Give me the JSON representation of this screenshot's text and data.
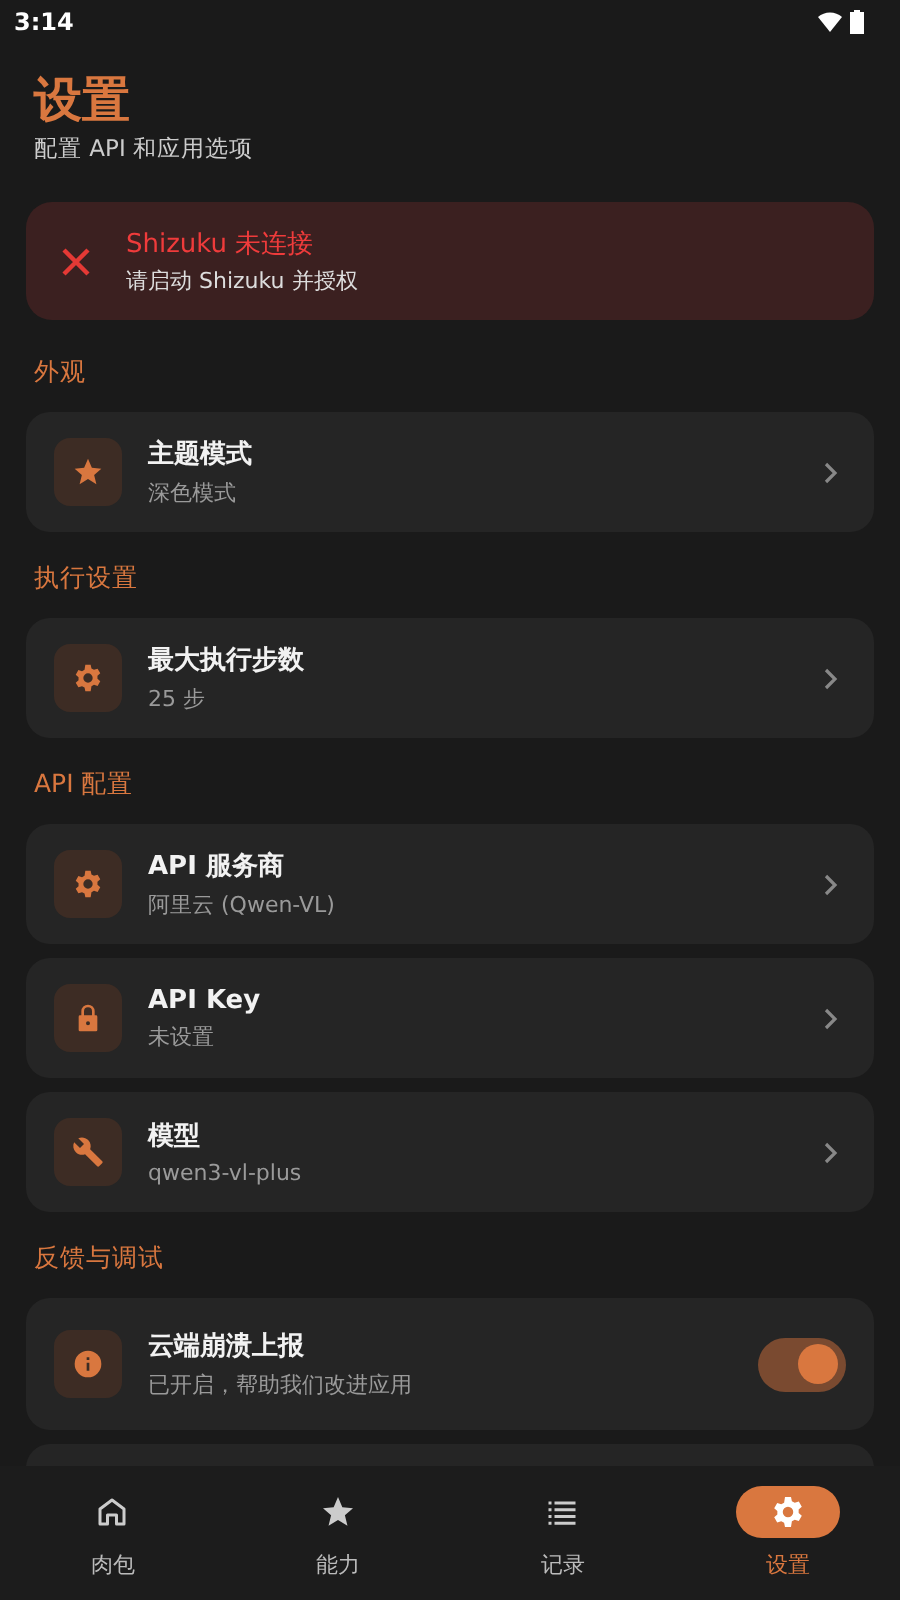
{
  "status_bar": {
    "time": "3:14"
  },
  "header": {
    "title": "设置",
    "subtitle": "配置 API 和应用选项"
  },
  "alert": {
    "title": "Shizuku 未连接",
    "message": "请启动 Shizuku 并授权"
  },
  "sections": [
    {
      "label": "外观",
      "items": [
        {
          "kind": "link",
          "title": "主题模式",
          "subtitle": "深色模式"
        }
      ]
    },
    {
      "label": "执行设置",
      "items": [
        {
          "kind": "link",
          "title": "最大执行步数",
          "subtitle": "25 步"
        }
      ]
    },
    {
      "label": "API 配置",
      "items": [
        {
          "kind": "link",
          "title": "API 服务商",
          "subtitle": "阿里云 (Qwen-VL)"
        },
        {
          "kind": "link",
          "title": "API Key",
          "subtitle": "未设置"
        },
        {
          "kind": "link",
          "title": "模型",
          "subtitle": "qwen3-vl-plus"
        }
      ]
    },
    {
      "label": "反馈与调试",
      "items": [
        {
          "kind": "toggle",
          "title": "云端崩溃上报",
          "subtitle": "已开启，帮助我们改进应用",
          "on": true
        }
      ]
    }
  ],
  "bottom_nav": [
    {
      "label": "肉包",
      "selected": false
    },
    {
      "label": "能力",
      "selected": false
    },
    {
      "label": "记录",
      "selected": false
    },
    {
      "label": "设置",
      "selected": true
    }
  ]
}
